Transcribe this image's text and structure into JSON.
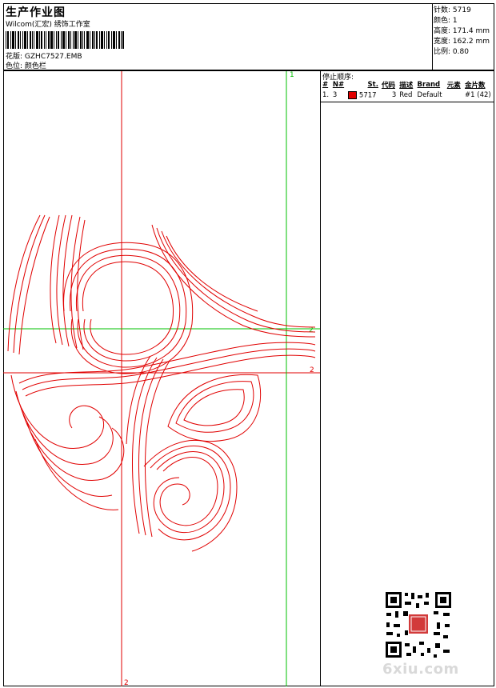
{
  "header": {
    "title": "生产作业图",
    "subtitle": "Wilcom(汇宏) 绣饰工作室",
    "design_label": "花版:",
    "design_value": "GZHC7527.EMB",
    "colorpos_label": "色位:",
    "colorpos_value": "颜色栏"
  },
  "stats": {
    "stitches": "针数: 5719",
    "colors": "颜色: 1",
    "height": "高度: 171.4 mm",
    "width": "宽度: 162.2 mm",
    "scale": "比例: 0.80"
  },
  "stop_sequence": {
    "title": "停止顺序:",
    "columns": [
      "#",
      "N#",
      "St.",
      "代码",
      "描述",
      "Brand",
      "元素",
      "金片数"
    ],
    "rows": [
      {
        "num": "1.",
        "needle": "3",
        "color": "#e00000",
        "stitches": "5717",
        "code": "3",
        "desc": "Red",
        "brand": "Default",
        "sequin": "#1 (42)"
      }
    ]
  },
  "guides": {
    "label_1": "1",
    "label_2": "2",
    "label_2b": "2",
    "label_2c": "2"
  },
  "colors": {
    "thread": "#e00000",
    "guide_red": "#e00000",
    "guide_green": "#00c000"
  },
  "watermark": "6xiu.com"
}
